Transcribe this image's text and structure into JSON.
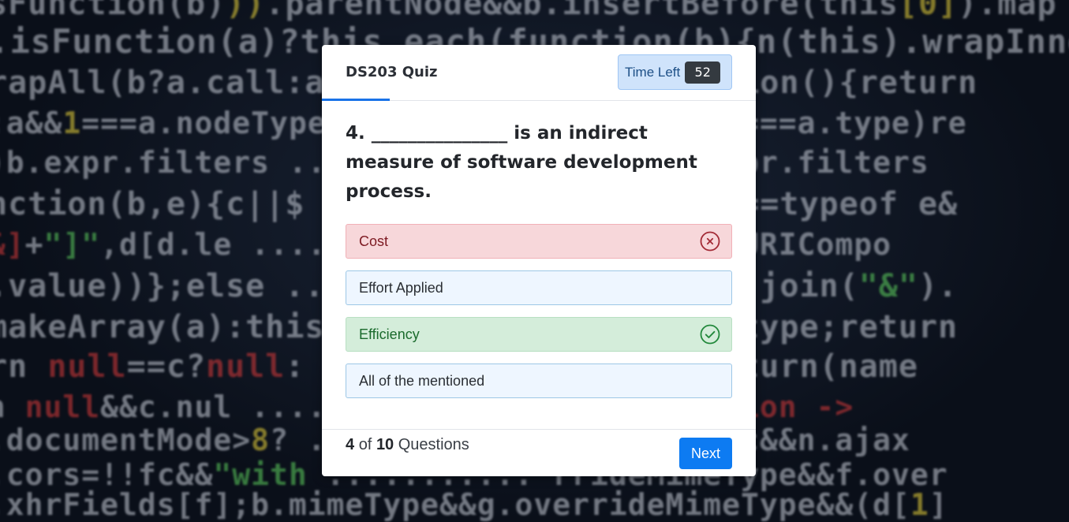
{
  "quiz": {
    "title": "DS203 Quiz",
    "timer_label": "Time Left",
    "timer_value": "52"
  },
  "question": {
    "text": "4. _______________ is an indirect measure of software development process."
  },
  "options": [
    {
      "label": "Cost",
      "state": "wrong",
      "icon": "x-circle-icon"
    },
    {
      "label": "Effort Applied",
      "state": "neutral"
    },
    {
      "label": "Efficiency",
      "state": "correct",
      "icon": "check-circle-icon"
    },
    {
      "label": "All of the mentioned",
      "state": "neutral"
    }
  ],
  "footer": {
    "current": "4",
    "of_word": "of",
    "total": "10",
    "questions_word": "Questions",
    "next_label": "Next"
  },
  "colors": {
    "accent": "#0d7bf2",
    "wrong": "#f7d7da",
    "correct": "#d4edda",
    "neutral": "#eef6ff"
  }
}
